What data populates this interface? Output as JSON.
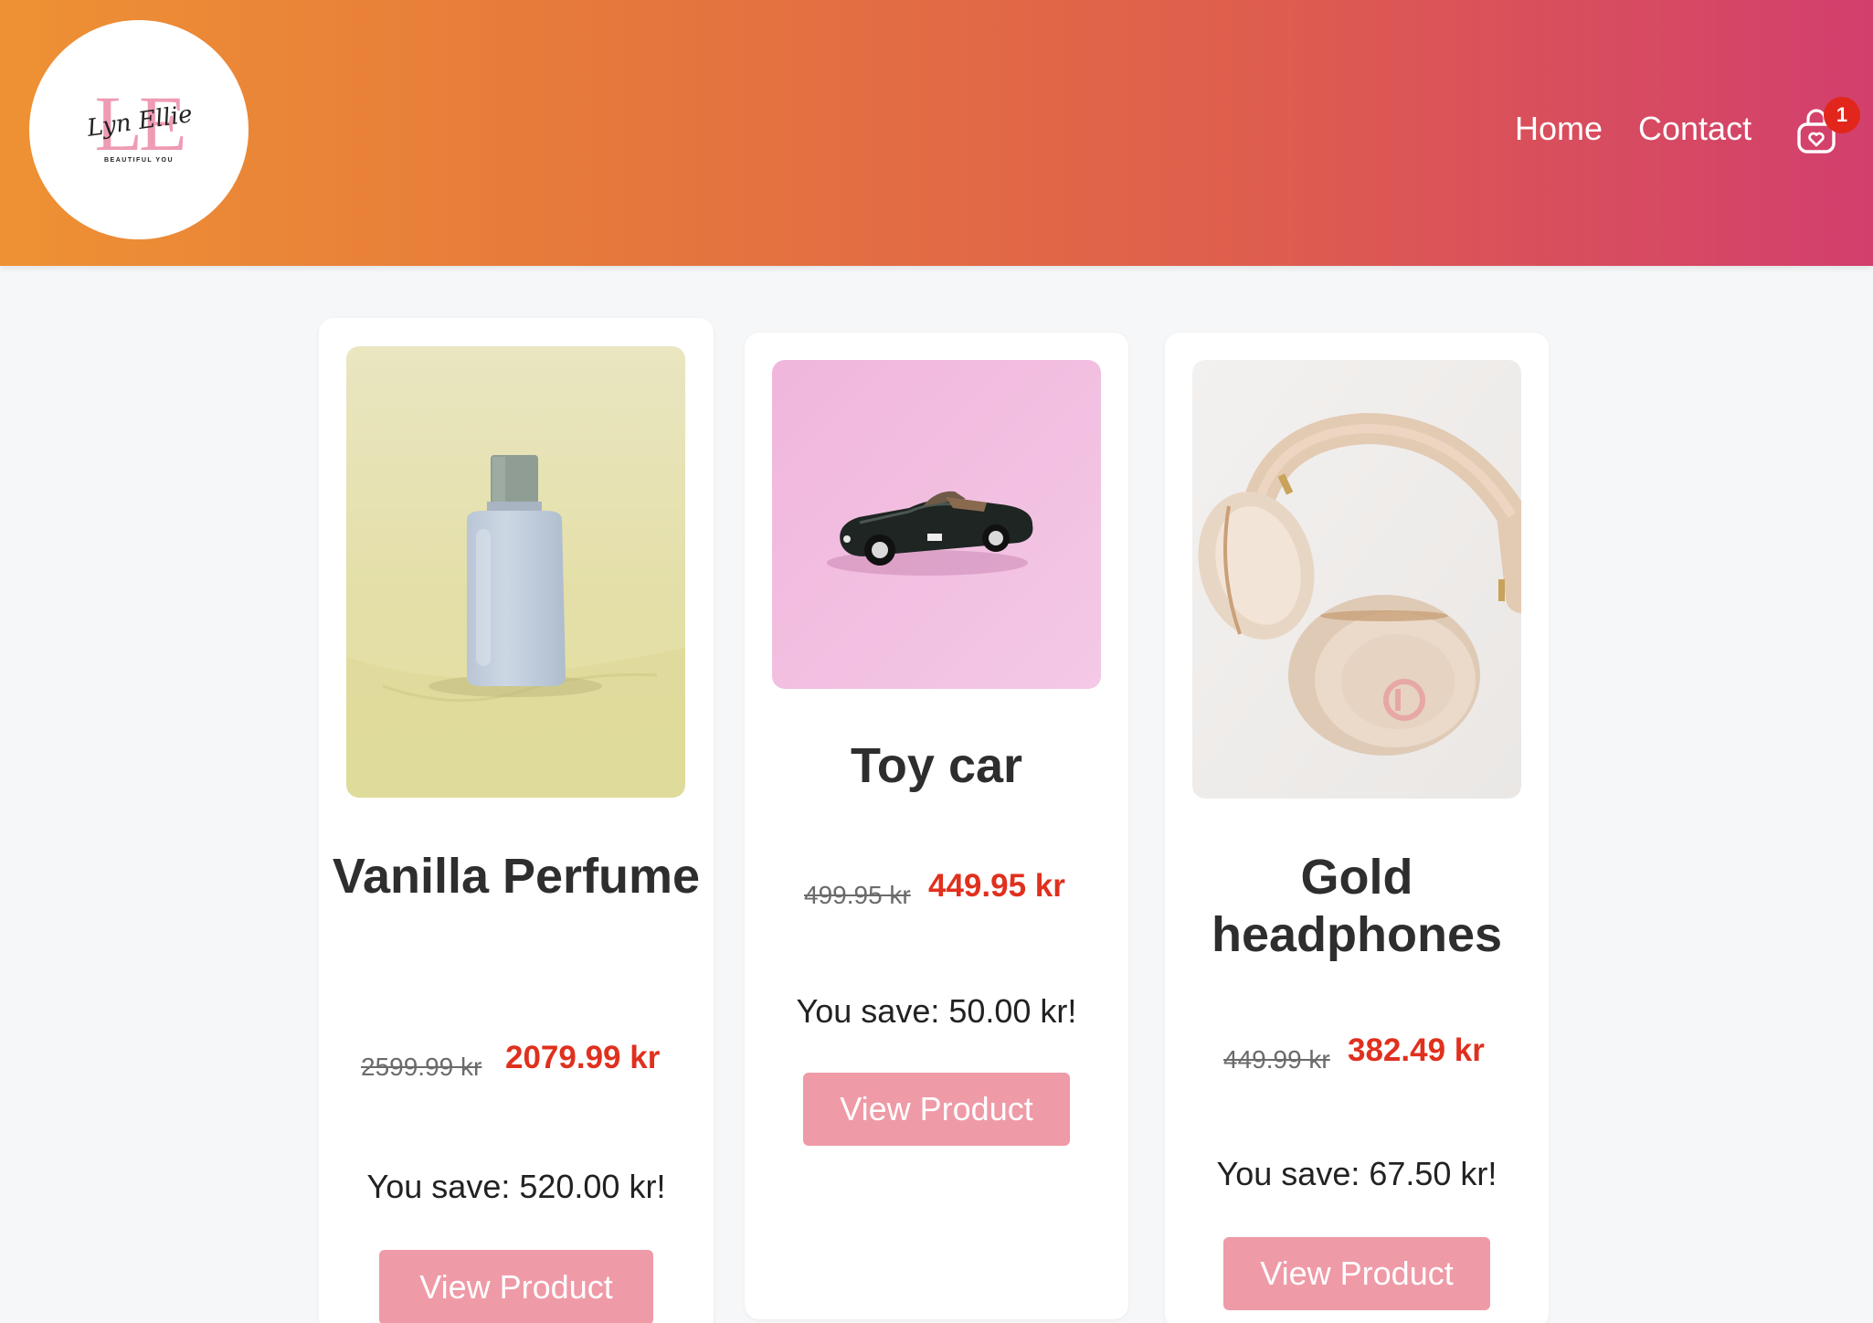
{
  "header": {
    "logo": {
      "monogram": "LE",
      "script": "Lyn Ellie",
      "tagline": "BEAUTIFUL YOU"
    },
    "nav": [
      {
        "label": "Home"
      },
      {
        "label": "Contact"
      }
    ],
    "cart": {
      "icon": "shopping-bag-heart-icon",
      "count": "1"
    }
  },
  "colors": {
    "header_gradient": [
      "#ee9134",
      "#d23f6d"
    ],
    "price_red": "#e0301e",
    "button_pink": "#ef9aa7",
    "badge_red": "#e3261b"
  },
  "products": [
    {
      "title": "Vanilla Perfume",
      "image": "perfume-bottle-image",
      "old_price": "2599.99 kr",
      "price": "2079.99 kr",
      "savings": "You save: 520.00 kr!",
      "button": "View Product"
    },
    {
      "title": "Toy car",
      "image": "toy-car-image",
      "old_price": "499.95 kr",
      "price": "449.95 kr",
      "savings": "You save: 50.00 kr!",
      "button": "View Product"
    },
    {
      "title": "Gold headphones",
      "image": "headphones-image",
      "old_price": "449.99 kr",
      "price": "382.49 kr",
      "savings": "You save: 67.50 kr!",
      "button": "View Product"
    }
  ]
}
